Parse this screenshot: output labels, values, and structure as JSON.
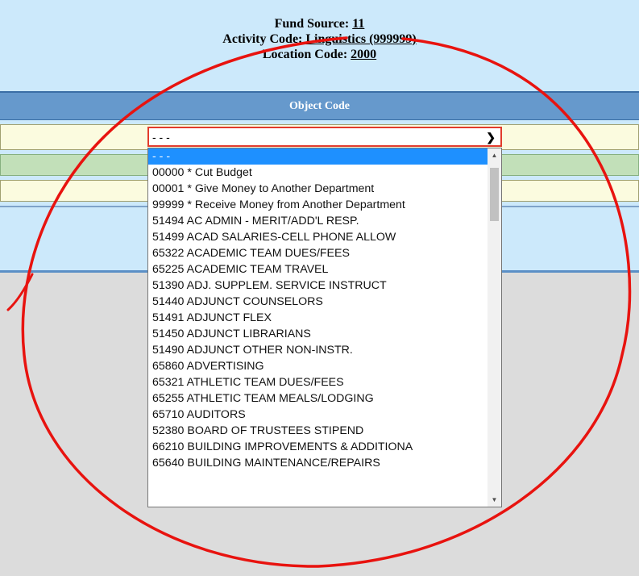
{
  "header": {
    "fund_source_label": "Fund Source: ",
    "fund_source_value": "11",
    "activity_code_label": "Activity Code: ",
    "activity_code_value": "Linguistics (999999)",
    "location_code_label": "Location Code: ",
    "location_code_value": "2000"
  },
  "object_code": {
    "title": "Object Code",
    "select_value": "- - -",
    "options": [
      "- - -",
      "00000 * Cut Budget",
      "00001 * Give Money to Another Department",
      "99999 * Receive Money from Another Department",
      "51494 AC ADMIN - MERIT/ADD'L RESP.",
      "51499 ACAD SALARIES-CELL PHONE ALLOW",
      "65322 ACADEMIC TEAM DUES/FEES",
      "65225 ACADEMIC TEAM TRAVEL",
      "51390 ADJ. SUPPLEM. SERVICE INSTRUCT",
      "51440 ADJUNCT COUNSELORS",
      "51491 ADJUNCT FLEX",
      "51450 ADJUNCT LIBRARIANS",
      "51490 ADJUNCT OTHER NON-INSTR.",
      "65860 ADVERTISING",
      "65321 ATHLETIC TEAM DUES/FEES",
      "65255 ATHLETIC TEAM MEALS/LODGING",
      "65710 AUDITORS",
      "52380 BOARD OF TRUSTEES STIPEND",
      "66210 BUILDING IMPROVEMENTS & ADDITIONA",
      "65640 BUILDING MAINTENANCE/REPAIRS"
    ]
  },
  "colors": {
    "annotation": "#e8130f",
    "selected_option": "#1e90ff",
    "header_bar": "#6699cc"
  },
  "icons": {
    "dropdown": "chevron-down-icon",
    "scroll_up": "scroll-up-arrow-icon",
    "scroll_down": "scroll-down-arrow-icon"
  }
}
